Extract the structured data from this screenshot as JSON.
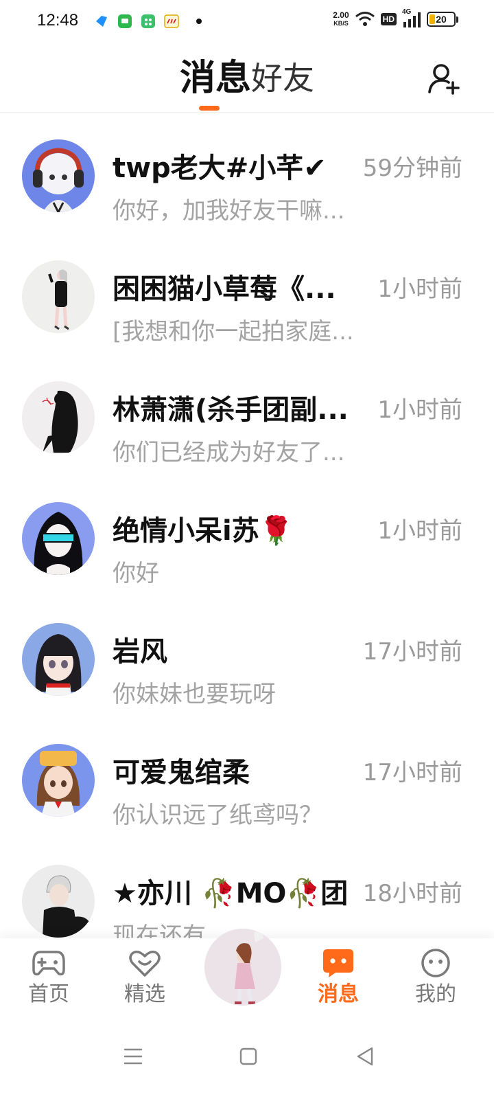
{
  "status_bar": {
    "time": "12:48",
    "net_speed_value": "2.00",
    "net_speed_unit": "KB/S",
    "hd_label": "HD",
    "network_label": "4G",
    "battery_level": "20",
    "battery_fraction": 0.2
  },
  "header": {
    "tab_messages": "消息",
    "tab_friends": "好友"
  },
  "conversations": [
    {
      "name": "twp老大#小芊✔",
      "time": "59分钟前",
      "preview": "你好，加我好友干嘛..."
    },
    {
      "name": "困困猫小草莓《...",
      "time": "1小时前",
      "preview": "[我想和你一起拍家庭..."
    },
    {
      "name": "林萧潇(杀手团副...",
      "time": "1小时前",
      "preview": "你们已经成为好友了..."
    },
    {
      "name": "绝情小呆i苏",
      "name_emoji": "🌹",
      "time": "1小时前",
      "preview": "你好"
    },
    {
      "name": "岩风",
      "time": "17小时前",
      "preview": "你妹妹也要玩呀"
    },
    {
      "name": "可爱鬼绾柔",
      "time": "17小时前",
      "preview": "你认识远了纸鸢吗？"
    },
    {
      "name": "★亦川 🥀MO🥀团",
      "time": "18小时前",
      "preview": "现在还有..."
    }
  ],
  "bottom_nav": {
    "home": "首页",
    "featured": "精选",
    "messages": "消息",
    "me": "我的"
  },
  "colors": {
    "accent": "#ff6a1a",
    "time_gray": "#9a9a9a",
    "preview_gray": "#a3a3a3"
  }
}
